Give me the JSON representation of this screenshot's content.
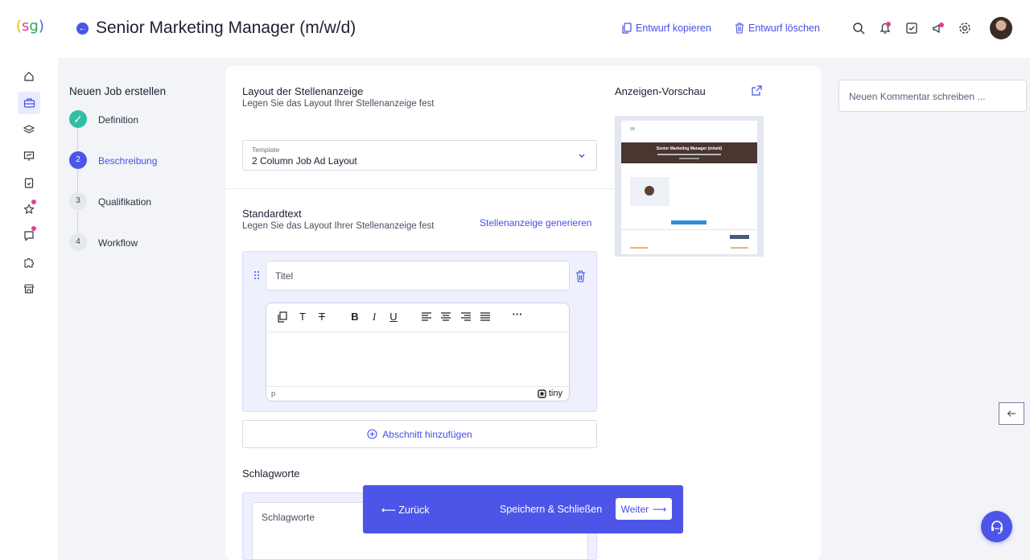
{
  "app": {
    "logo_text": "(sg)"
  },
  "header": {
    "title": "Senior Marketing Manager (m/w/d)",
    "copy_draft_label": "Entwurf kopieren",
    "delete_draft_label": "Entwurf löschen"
  },
  "sidebar": {
    "items": [
      {
        "name": "home-icon"
      },
      {
        "name": "briefcase-icon",
        "active": true
      },
      {
        "name": "layers-icon"
      },
      {
        "name": "presentation-icon"
      },
      {
        "name": "clipboard-check-icon"
      },
      {
        "name": "star-icon",
        "badge": true
      },
      {
        "name": "chat-icon",
        "badge": true
      },
      {
        "name": "puzzle-icon"
      },
      {
        "name": "store-icon"
      }
    ]
  },
  "stepper": {
    "title": "Neuen Job erstellen",
    "steps": [
      {
        "number": "✓",
        "label": "Definition",
        "state": "done"
      },
      {
        "number": "2",
        "label": "Beschreibung",
        "state": "active"
      },
      {
        "number": "3",
        "label": "Qualifikation",
        "state": "pending"
      },
      {
        "number": "4",
        "label": "Workflow",
        "state": "pending"
      }
    ]
  },
  "layout_section": {
    "title": "Layout der Stellenanzeige",
    "subtitle": "Legen Sie das Layout Ihrer Stellenanzeige fest",
    "template_label": "Template",
    "template_value": "2 Column Job Ad Layout"
  },
  "standard_text": {
    "title": "Standardtext",
    "subtitle": "Legen Sie das Layout Ihrer Stellenanzeige fest",
    "generate_link": "Stellenanzeige generieren",
    "title_placeholder": "Titel",
    "editor_status": "p",
    "editor_brand": "tiny",
    "add_section_label": "Abschnitt hinzufügen"
  },
  "keywords": {
    "title": "Schlagworte",
    "placeholder": "Schlagworte"
  },
  "preview": {
    "title": "Anzeigen-Vorschau",
    "ad_title": "Senior Marketing Manager (m/w/d)"
  },
  "action_bar": {
    "back_label": "Zurück",
    "save_label": "Speichern & Schließen",
    "next_label": "Weiter"
  },
  "comments": {
    "placeholder": "Neuen Kommentar schreiben ..."
  },
  "colors": {
    "primary": "#4c55e8",
    "success": "#2ebfa5",
    "badge": "#e13f97",
    "background": "#f3f4f8"
  }
}
